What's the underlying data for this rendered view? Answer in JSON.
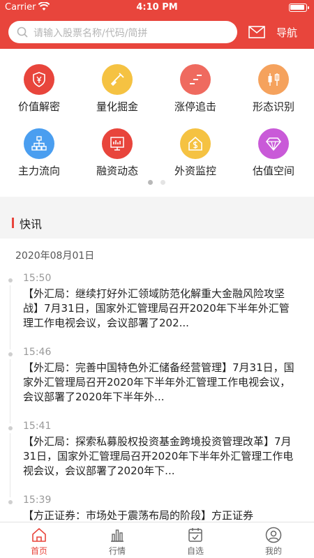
{
  "status_bar": {
    "carrier": "Carrier",
    "time": "4:10 PM"
  },
  "header": {
    "search_placeholder": "请输入股票名称/代码/简拼",
    "mail_icon": "mail-icon",
    "nav_label": "导航"
  },
  "colors": {
    "brand": "#e8453c",
    "tab_active": "#e8453c",
    "tab_inactive": "#666666"
  },
  "features": [
    {
      "label": "价值解密",
      "icon": "shield-yen-icon",
      "color": "#e8453c"
    },
    {
      "label": "量化掘金",
      "icon": "shovel-icon",
      "color": "#f5c242"
    },
    {
      "label": "涨停追击",
      "icon": "rising-bars-icon",
      "color": "#ef6a5f"
    },
    {
      "label": "形态识别",
      "icon": "candlestick-icon",
      "color": "#f5a25d"
    },
    {
      "label": "主力流向",
      "icon": "org-chart-icon",
      "color": "#4a9ef0"
    },
    {
      "label": "融资动态",
      "icon": "monitor-chart-icon",
      "color": "#e8453c"
    },
    {
      "label": "外资监控",
      "icon": "dollar-house-icon",
      "color": "#f5c242"
    },
    {
      "label": "估值空间",
      "icon": "diamond-icon",
      "color": "#c95ad8"
    }
  ],
  "pager": {
    "active_index": 0,
    "count": 2
  },
  "section": {
    "title": "快讯"
  },
  "news_date": "2020年08月01日",
  "news": [
    {
      "time": "15:50",
      "text": "【外汇局：继续打好外汇领域防范化解重大金融风险攻坚战】7月31日，国家外汇管理局召开2020年下半年外汇管理工作电视会议，会议部署了202..."
    },
    {
      "time": "15:46",
      "text": "【外汇局：完善中国特色外汇储备经营管理】7月31日，国家外汇管理局召开2020年下半年外汇管理工作电视会议，会议部署了2020年下半年外..."
    },
    {
      "time": "15:41",
      "text": "【外汇局：探索私募股权投资基金跨境投资管理改革】7月31日，国家外汇管理局召开2020年下半年外汇管理工作电视会议，会议部署了2020年下..."
    },
    {
      "time": "15:39",
      "text": "【方正证券：市场处于震荡布局的阶段】方正证券"
    }
  ],
  "tabs": [
    {
      "label": "首页",
      "icon": "home-icon",
      "active": true
    },
    {
      "label": "行情",
      "icon": "bar-chart-icon",
      "active": false
    },
    {
      "label": "自选",
      "icon": "calendar-check-icon",
      "active": false
    },
    {
      "label": "我的",
      "icon": "user-icon",
      "active": false
    }
  ]
}
